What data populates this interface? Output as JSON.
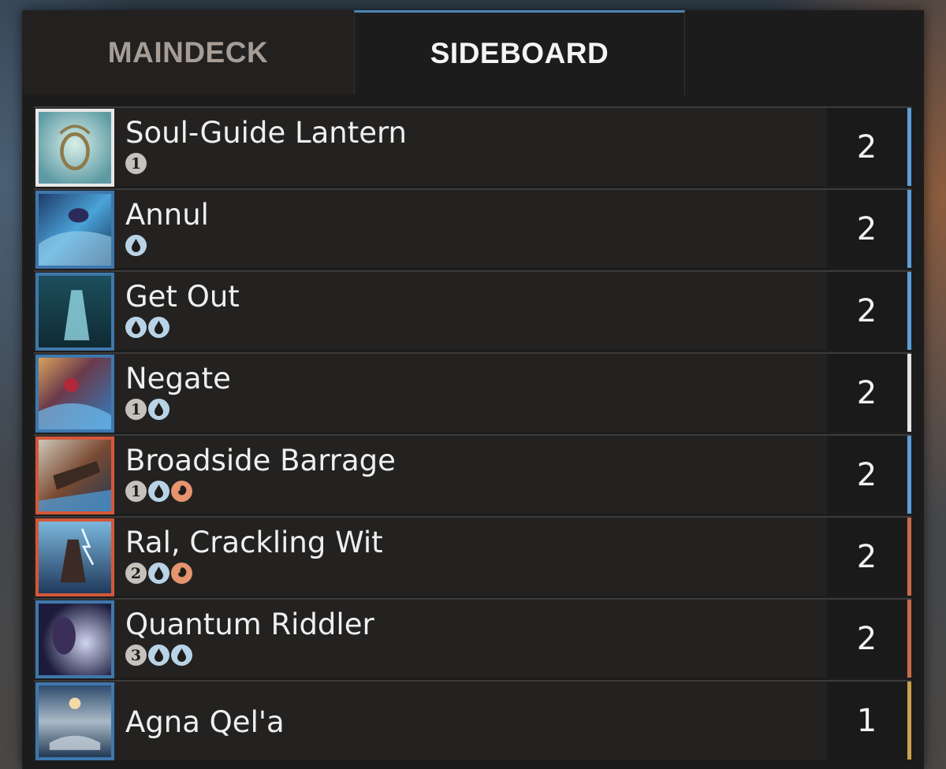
{
  "tabs": {
    "maindeck": "MAINDECK",
    "sideboard": "SIDEBOARD"
  },
  "colors": {
    "blue_border": "#3f78ad",
    "red_border": "#d3583a",
    "white_border": "#e8e8e8",
    "bar_blue": "#5b9fd6",
    "bar_red": "#c96a4a",
    "bar_white": "#e6e6e6",
    "bar_gold": "#c9a24b"
  },
  "cards": [
    {
      "name": "Soul-Guide Lantern",
      "count": "2",
      "cost": [
        "1"
      ],
      "frame": "white",
      "bar": "blue"
    },
    {
      "name": "Annul",
      "count": "2",
      "cost": [
        "U"
      ],
      "frame": "blue",
      "bar": "blue"
    },
    {
      "name": "Get Out",
      "count": "2",
      "cost": [
        "U",
        "U"
      ],
      "frame": "blue",
      "bar": "blue"
    },
    {
      "name": "Negate",
      "count": "2",
      "cost": [
        "1",
        "U"
      ],
      "frame": "blue",
      "bar": "white"
    },
    {
      "name": "Broadside Barrage",
      "count": "2",
      "cost": [
        "1",
        "U",
        "R"
      ],
      "frame": "red",
      "bar": "blue"
    },
    {
      "name": "Ral, Crackling Wit",
      "count": "2",
      "cost": [
        "2",
        "U",
        "R"
      ],
      "frame": "red",
      "bar": "red"
    },
    {
      "name": "Quantum Riddler",
      "count": "2",
      "cost": [
        "3",
        "U",
        "U"
      ],
      "frame": "blue",
      "bar": "red"
    },
    {
      "name": "Agna Qel'a",
      "count": "1",
      "cost": [],
      "frame": "blue",
      "bar": "gold"
    }
  ]
}
